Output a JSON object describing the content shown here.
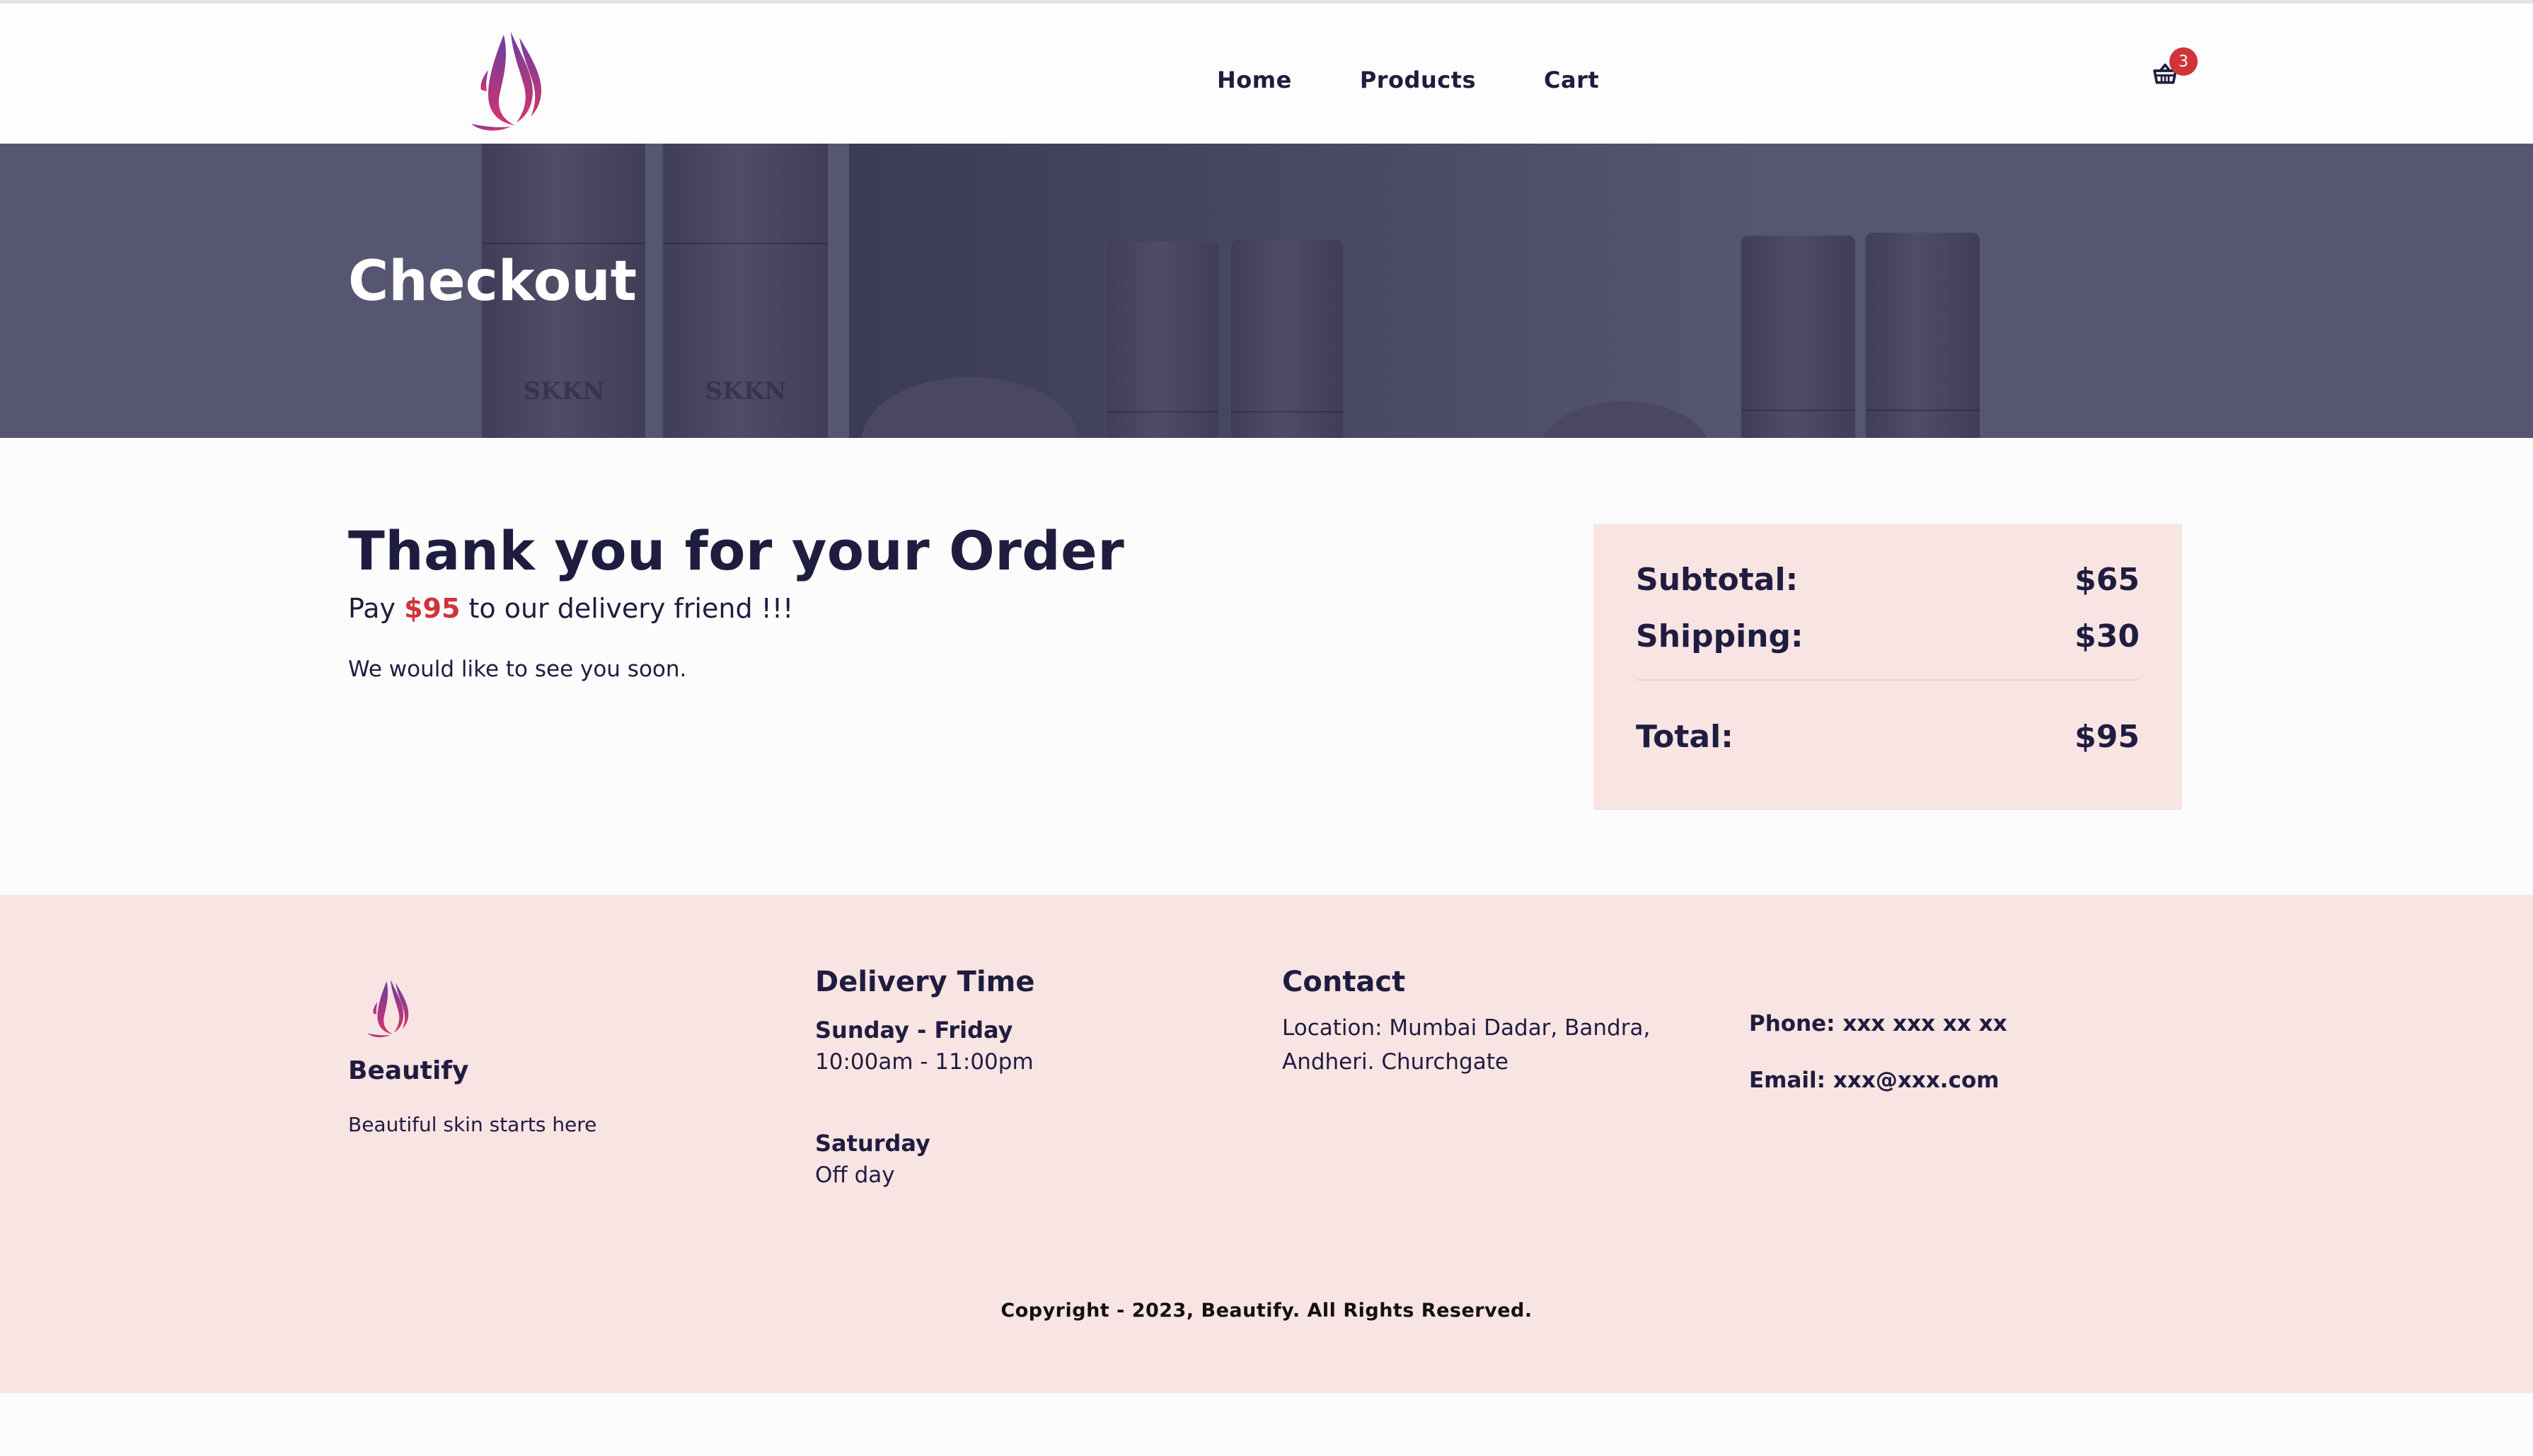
{
  "nav": {
    "links": [
      "Home",
      "Products",
      "Cart"
    ],
    "cart_count": "3"
  },
  "hero": {
    "title": "Checkout",
    "bottle_brand": "SKKN"
  },
  "main": {
    "title": "Thank you for your Order",
    "pay_prefix": "Pay",
    "pay_amount": "$95",
    "pay_suffix": "to our delivery friend !!!",
    "note": "We would like to see you soon."
  },
  "summary": {
    "subtotal_label": "Subtotal:",
    "subtotal_value": "$65",
    "shipping_label": "Shipping:",
    "shipping_value": "$30",
    "total_label": "Total:",
    "total_value": "$95"
  },
  "footer": {
    "brand": "Beautify",
    "tagline": "Beautiful skin starts here",
    "delivery_heading": "Delivery Time",
    "weekdays_label": "Sunday - Friday",
    "weekdays_hours": "10:00am - 11:00pm",
    "saturday_label": "Saturday",
    "saturday_hours": "Off day",
    "contact_heading": "Contact",
    "location_line1": "Location: Mumbai Dadar, Bandra,",
    "location_line2": "Andheri. Churchgate",
    "phone": "Phone: xxx xxx xx xx",
    "email": "Email: xxx@xxx.com",
    "copyright": "Copyright - 2023, Beautify. All Rights Reserved."
  },
  "colors": {
    "navy": "#1f1d3f",
    "accent_red": "#d0333a",
    "pink_panel": "#f9e4e4",
    "hero_overlay": "#565672",
    "logo_gradient_top": "#6b3fa0",
    "logo_gradient_bottom": "#d6336c"
  },
  "icons": {
    "logo": "woman-hair-silhouette-logo",
    "cart": "shopping-basket-icon"
  }
}
